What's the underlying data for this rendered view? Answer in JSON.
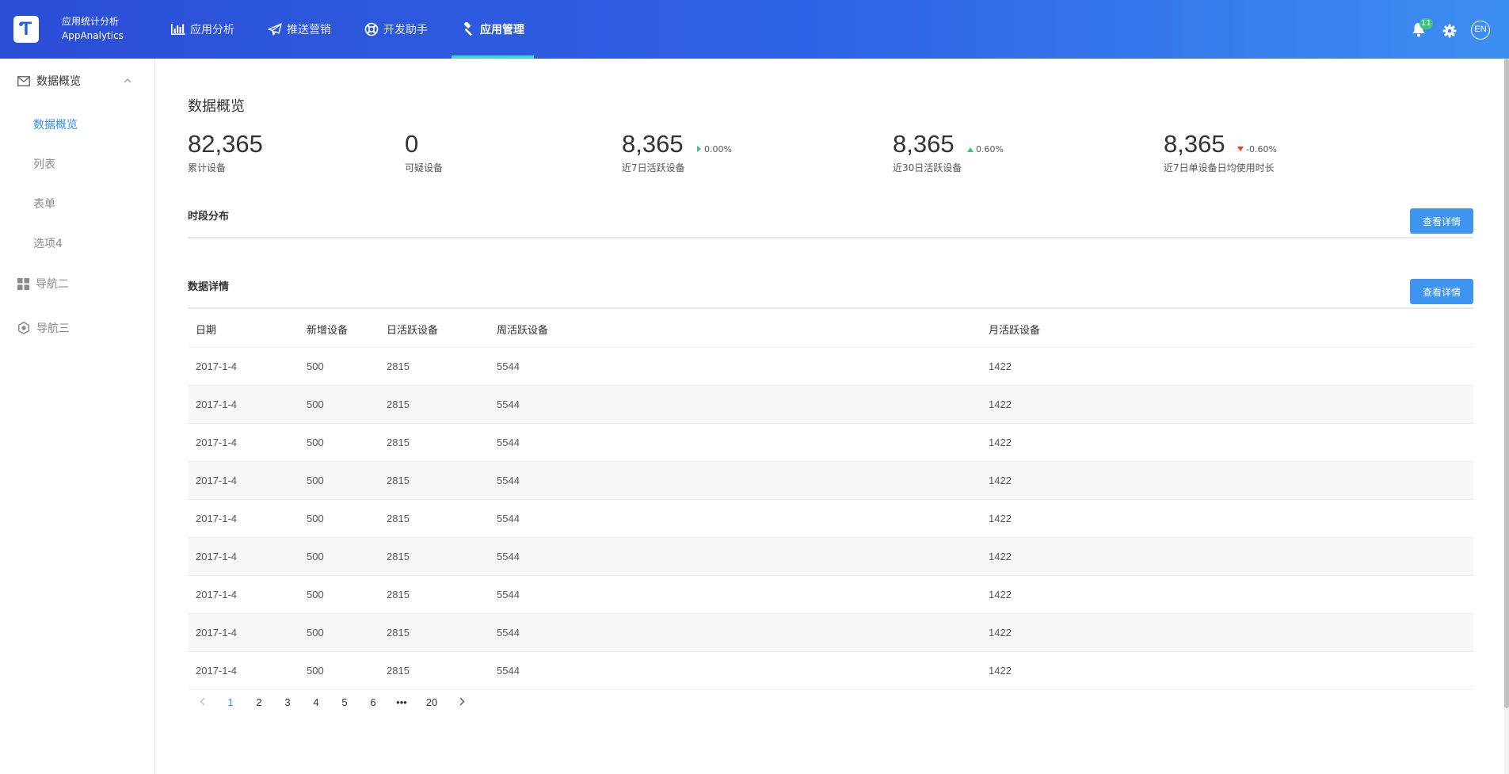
{
  "header": {
    "logo_letter": "T",
    "brand_cn": "应用统计分析",
    "brand_en": "AppAnalytics",
    "nav": [
      {
        "label": "应用分析",
        "icon": "bar-chart-icon"
      },
      {
        "label": "推送营销",
        "icon": "paper-plane-icon"
      },
      {
        "label": "开发助手",
        "icon": "lifebuoy-icon"
      },
      {
        "label": "应用管理",
        "icon": "gavel-icon",
        "active": true
      }
    ],
    "notification_count": "11",
    "lang_label": "EN"
  },
  "sidebar": {
    "group1_label": "数据概览",
    "subitems": [
      "数据概览",
      "列表",
      "表单",
      "选项4"
    ],
    "group2_label": "导航二",
    "group3_label": "导航三"
  },
  "overview": {
    "title": "数据概览",
    "stats": [
      {
        "value": "82,365",
        "label": "累计设备",
        "change": ""
      },
      {
        "value": "0",
        "label": "可疑设备",
        "change": ""
      },
      {
        "value": "8,365",
        "label": "近7日活跃设备",
        "change": "0.00%",
        "trend": "flat"
      },
      {
        "value": "8,365",
        "label": "近30日活跃设备",
        "change": "0.60%",
        "trend": "up"
      },
      {
        "value": "8,365",
        "label": "近7日单设备日均使用时长",
        "change": "-0.60%",
        "trend": "down"
      }
    ]
  },
  "time_dist": {
    "title": "时段分布",
    "button": "查看详情"
  },
  "details": {
    "title": "数据详情",
    "button": "查看详情",
    "columns": [
      "日期",
      "新增设备",
      "日活跃设备",
      "周活跃设备",
      "月活跃设备"
    ],
    "rows": [
      [
        "2017-1-4",
        "500",
        "2815",
        "5544",
        "1422"
      ],
      [
        "2017-1-4",
        "500",
        "2815",
        "5544",
        "1422"
      ],
      [
        "2017-1-4",
        "500",
        "2815",
        "5544",
        "1422"
      ],
      [
        "2017-1-4",
        "500",
        "2815",
        "5544",
        "1422"
      ],
      [
        "2017-1-4",
        "500",
        "2815",
        "5544",
        "1422"
      ],
      [
        "2017-1-4",
        "500",
        "2815",
        "5544",
        "1422"
      ],
      [
        "2017-1-4",
        "500",
        "2815",
        "5544",
        "1422"
      ],
      [
        "2017-1-4",
        "500",
        "2815",
        "5544",
        "1422"
      ],
      [
        "2017-1-4",
        "500",
        "2815",
        "5544",
        "1422"
      ]
    ]
  },
  "pagination": {
    "pages": [
      "1",
      "2",
      "3",
      "4",
      "5",
      "6"
    ],
    "ellipsis": "•••",
    "last": "20",
    "current": "1"
  },
  "colors": {
    "header_start": "#2b4ed6",
    "header_end": "#3d8ef2",
    "accent": "#2d8cf0",
    "tab_indicator": "#3fd8c8",
    "up": "#3ac47d",
    "down": "#ed4014"
  }
}
